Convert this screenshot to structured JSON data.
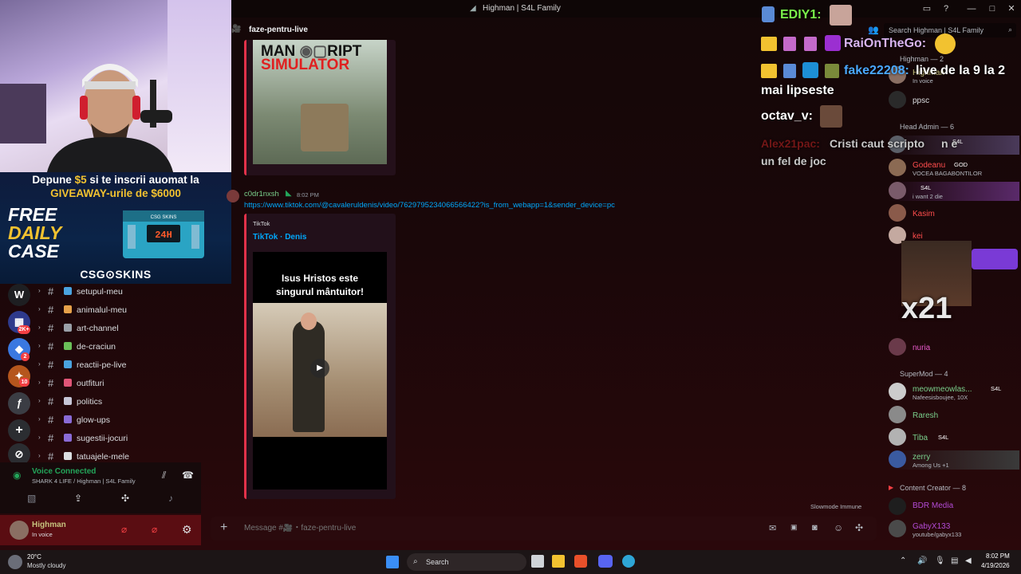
{
  "window": {
    "title": "Highman | S4L Family"
  },
  "header": {
    "channel": "faze-pentru-live",
    "search_placeholder": "Search Highman | S4L Family"
  },
  "promo": {
    "line1_a": "Depune ",
    "line1_amount": "$5",
    "line1_b": " si te inscrii auomat la",
    "line2_a": "GIVEAWAY-urile de ",
    "line2_amount": "$6000",
    "free": "FREE",
    "daily": "DAILY",
    "case": "CASE",
    "crate_label": "24H",
    "crate_brand": "CSG SKINS",
    "brand": "CSG⊙SKINS"
  },
  "servers": [
    {
      "label": "W",
      "badge": ""
    },
    {
      "label": "▦",
      "badge": "2K+"
    },
    {
      "label": "◆",
      "badge": "2"
    },
    {
      "label": "✦",
      "badge": "10"
    },
    {
      "label": "ƒ",
      "badge": ""
    },
    {
      "label": "+",
      "badge": ""
    },
    {
      "label": "⊘",
      "badge": ""
    }
  ],
  "channels": [
    {
      "name": "setupul-meu",
      "color": "#4aa3df"
    },
    {
      "name": "animalul-meu",
      "color": "#e7a14a"
    },
    {
      "name": "art-channel",
      "color": "#dbdee1"
    },
    {
      "name": "de-craciun",
      "color": "#6bbf59"
    },
    {
      "name": "reactii-pe-live",
      "color": "#4aa3df"
    },
    {
      "name": "outfituri",
      "color": "#e05577"
    },
    {
      "name": "politics",
      "color": "#c7c7d7"
    },
    {
      "name": "glow-ups",
      "color": "#8a6bd6"
    },
    {
      "name": "sugestii-jocuri",
      "color": "#8a6bd6"
    },
    {
      "name": "tatuajele-mele",
      "color": "#dbdee1"
    }
  ],
  "voice": {
    "status": "Voice Connected",
    "location": "SHARK 4 LIFE / Highman | S4L Family"
  },
  "user": {
    "name": "Highman",
    "status": "In voice"
  },
  "messages": {
    "embed1_title_a": "MAN",
    "embed1_title_b": "RIPT",
    "embed1_subtitle": "SIMULATOR",
    "author": "c0dr1nxsh",
    "time": "8:02 PM",
    "link": "https://www.tiktok.com/@cavaleruldenis/video/7629795234066566422?is_from_webapp=1&sender_device=pc",
    "embed2_provider": "TikTok",
    "embed2_title": "TikTok · Denis",
    "video_caption": "Isus Hristos este singurul mântuitor!",
    "slowmode": "Slowmode Immune"
  },
  "composer": {
    "placeholder": "Message #🎥・faze-pentru-live"
  },
  "members": {
    "roles": [
      {
        "label": "Highman — 2"
      },
      {
        "label": "Head Admin — 6"
      },
      {
        "label": "SuperMod — 4"
      },
      {
        "label": "Content Creator — 8"
      }
    ],
    "list": [
      {
        "name": "Highman",
        "sub": "In voice",
        "color": "#c6c37e",
        "tag": ""
      },
      {
        "name": "ppsc",
        "sub": "",
        "color": "#dbdee1",
        "tag": ""
      },
      {
        "name": "",
        "sub": "",
        "color": "#e0a0e0",
        "tag": "S4L"
      },
      {
        "name": "Godeanu",
        "sub": "VOCEA BAGABONTILOR",
        "color": "#ff4d4d",
        "tag": "GOD"
      },
      {
        "name": "",
        "sub": "i want 2 die",
        "color": "#e8a0ff",
        "tag": "S4L"
      },
      {
        "name": "Kasim",
        "sub": "",
        "color": "#ff4d4d",
        "tag": ""
      },
      {
        "name": "kei",
        "sub": "",
        "color": "#ff4d4d",
        "tag": ""
      },
      {
        "name": "nuria",
        "sub": "",
        "color": "#e85acb",
        "tag": ""
      },
      {
        "name": "meowmeowlas...",
        "sub": "Nafeesisboujee, 10X",
        "color": "#7ad08c",
        "tag": "S4L"
      },
      {
        "name": "Raresh",
        "sub": "",
        "color": "#7ad08c",
        "tag": ""
      },
      {
        "name": "Tiba",
        "sub": "",
        "color": "#7ad08c",
        "tag": "S4L"
      },
      {
        "name": "zerry",
        "sub": "Among Us +1",
        "color": "#7ad08c",
        "tag": ""
      },
      {
        "name": "BDR Media",
        "sub": "",
        "color": "#b44bd6",
        "tag": ""
      },
      {
        "name": "GabyX133",
        "sub": "youtube/gabyx133",
        "color": "#b44bd6",
        "tag": ""
      }
    ]
  },
  "overlay": {
    "u1": "EDIY1:",
    "u2": "RaiOnTheGo:",
    "u3": "fake22208:",
    "m3": "live de la 9 la 2",
    "m3b": "mai lipseste",
    "u4": "octav_v:",
    "u5": "Alex21pac:",
    "m5": "Cristi caut scripto",
    "m5b": "n e",
    "m5c": "un fel de joc",
    "big": "x21"
  },
  "taskbar": {
    "weather_temp": "20°C",
    "weather_desc": "Mostly cloudy",
    "search": "Search",
    "time": "8:02 PM",
    "date": "4/19/2026"
  }
}
